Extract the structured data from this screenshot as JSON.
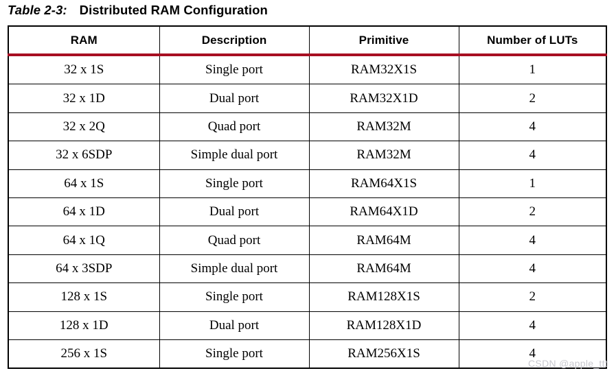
{
  "caption": {
    "label": "Table 2-3:",
    "title": "Distributed RAM Configuration"
  },
  "table": {
    "columns": [
      "RAM",
      "Description",
      "Primitive",
      "Number of LUTs"
    ],
    "rows": [
      {
        "ram": "32 x 1S",
        "description": "Single port",
        "primitive": "RAM32X1S",
        "luts": "1"
      },
      {
        "ram": "32 x 1D",
        "description": "Dual port",
        "primitive": "RAM32X1D",
        "luts": "2"
      },
      {
        "ram": "32 x 2Q",
        "description": "Quad port",
        "primitive": "RAM32M",
        "luts": "4"
      },
      {
        "ram": "32 x 6SDP",
        "description": "Simple dual port",
        "primitive": "RAM32M",
        "luts": "4"
      },
      {
        "ram": "64 x 1S",
        "description": "Single port",
        "primitive": "RAM64X1S",
        "luts": "1"
      },
      {
        "ram": "64 x 1D",
        "description": "Dual port",
        "primitive": "RAM64X1D",
        "luts": "2"
      },
      {
        "ram": "64 x 1Q",
        "description": "Quad port",
        "primitive": "RAM64M",
        "luts": "4"
      },
      {
        "ram": "64 x 3SDP",
        "description": "Simple dual port",
        "primitive": "RAM64M",
        "luts": "4"
      },
      {
        "ram": "128 x 1S",
        "description": "Single port",
        "primitive": "RAM128X1S",
        "luts": "2"
      },
      {
        "ram": "128 x 1D",
        "description": "Dual port",
        "primitive": "RAM128X1D",
        "luts": "4"
      },
      {
        "ram": "256 x 1S",
        "description": "Single port",
        "primitive": "RAM256X1S",
        "luts": "4"
      }
    ]
  },
  "watermark": {
    "text": "CSDN @apple_ttt"
  },
  "colors": {
    "accent_rule": "#a70f22",
    "border": "#000000",
    "text": "#000000",
    "watermark": "#c9c9cf",
    "background": "#ffffff"
  }
}
